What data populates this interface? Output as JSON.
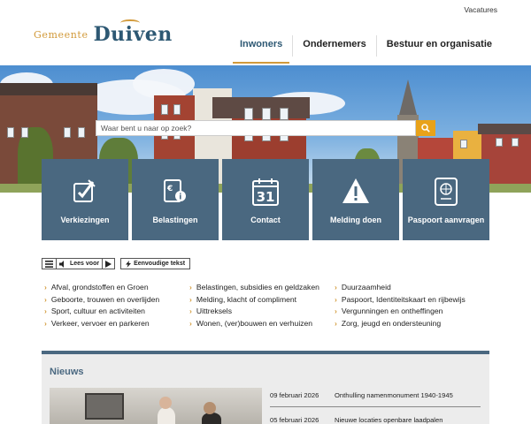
{
  "util": {
    "vacatures": "Vacatures"
  },
  "logo": {
    "small": "Gemeente",
    "big": "Duiven"
  },
  "nav": {
    "items": [
      {
        "label": "Inwoners",
        "active": true
      },
      {
        "label": "Ondernemers",
        "active": false
      },
      {
        "label": "Bestuur en organisatie",
        "active": false
      }
    ]
  },
  "search": {
    "placeholder": "Waar bent u naar op zoek?"
  },
  "tiles": [
    {
      "label": "Verkiezingen",
      "icon": "ballot-icon"
    },
    {
      "label": "Belastingen",
      "icon": "tax-icon"
    },
    {
      "label": "Contact",
      "icon": "calendar-icon",
      "icon_text": "31"
    },
    {
      "label": "Melding doen",
      "icon": "warning-icon"
    },
    {
      "label": "Paspoort aanvragen",
      "icon": "passport-icon"
    }
  ],
  "readbar": {
    "lees_voor": "Lees voor",
    "eenvoudige": "Eenvoudige tekst"
  },
  "links": {
    "col1": [
      "Afval, grondstoffen en Groen",
      "Geboorte, trouwen en overlijden",
      "Sport, cultuur en activiteiten",
      "Verkeer, vervoer en parkeren"
    ],
    "col2": [
      "Belastingen, subsidies en geldzaken",
      "Melding, klacht of compliment",
      "Uittreksels",
      "Wonen, (ver)bouwen en verhuizen"
    ],
    "col3": [
      "Duurzaamheid",
      "Paspoort, Identiteitskaart en rijbewijs",
      "Vergunningen en ontheffingen",
      "Zorg, jeugd en ondersteuning"
    ]
  },
  "news": {
    "title": "Nieuws",
    "items": [
      {
        "date": "09 februari 2026",
        "text": "Onthulling namenmonument 1940-1945"
      },
      {
        "date": "05 februari 2026",
        "text": "Nieuwe locaties openbare laadpalen"
      }
    ]
  },
  "colors": {
    "brand_blue": "#2d5873",
    "tile": "#4a6880",
    "accent": "#d29a3a",
    "search_button": "#e8a21a"
  }
}
